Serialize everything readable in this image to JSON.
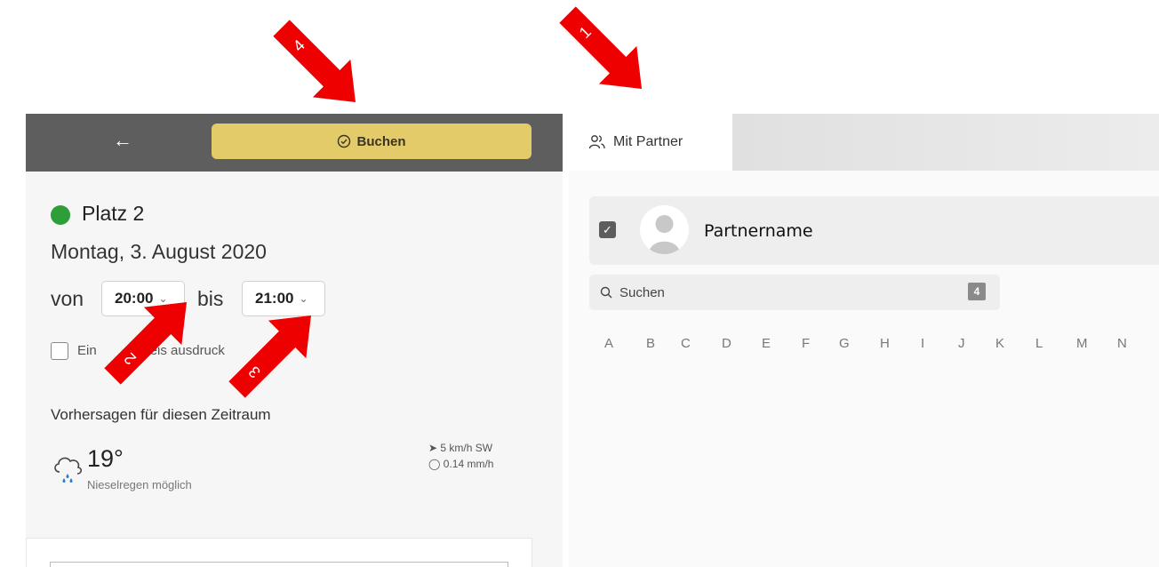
{
  "header": {
    "back_icon": "arrow-left-icon",
    "book_label": "Buchen",
    "book_icon": "check-circle-icon",
    "book_color": "#e4cb6a",
    "bar_color": "#5e5e5e"
  },
  "booking": {
    "court": "Platz 2",
    "court_status_color": "#2e9e38",
    "date": "Montag, 3. August 2020",
    "from_label": "von",
    "from_time": "20:00",
    "to_label": "bis",
    "to_time": "21:00",
    "print_label": "Ein        chweis ausdruck"
  },
  "forecast": {
    "title": "Vorhersagen für diesen Zeitraum",
    "icon": "rain-cloud-icon",
    "temperature": "19°",
    "description": "Nieselregen möglich",
    "wind": "5 km/h SW",
    "precipitation": "0.14 mm/h"
  },
  "partner_tab": {
    "label": "Mit Partner",
    "icon": "users-icon"
  },
  "partner": {
    "name": "Partnername",
    "checked": true
  },
  "search": {
    "placeholder": "Suchen",
    "count": "4"
  },
  "alphabet": [
    "A",
    "B",
    "C",
    "D",
    "E",
    "F",
    "G",
    "H",
    "I",
    "J",
    "K",
    "L",
    "M",
    "N"
  ],
  "annotations": [
    "1",
    "2",
    "3",
    "4"
  ],
  "annotation_color": "#ee0000"
}
